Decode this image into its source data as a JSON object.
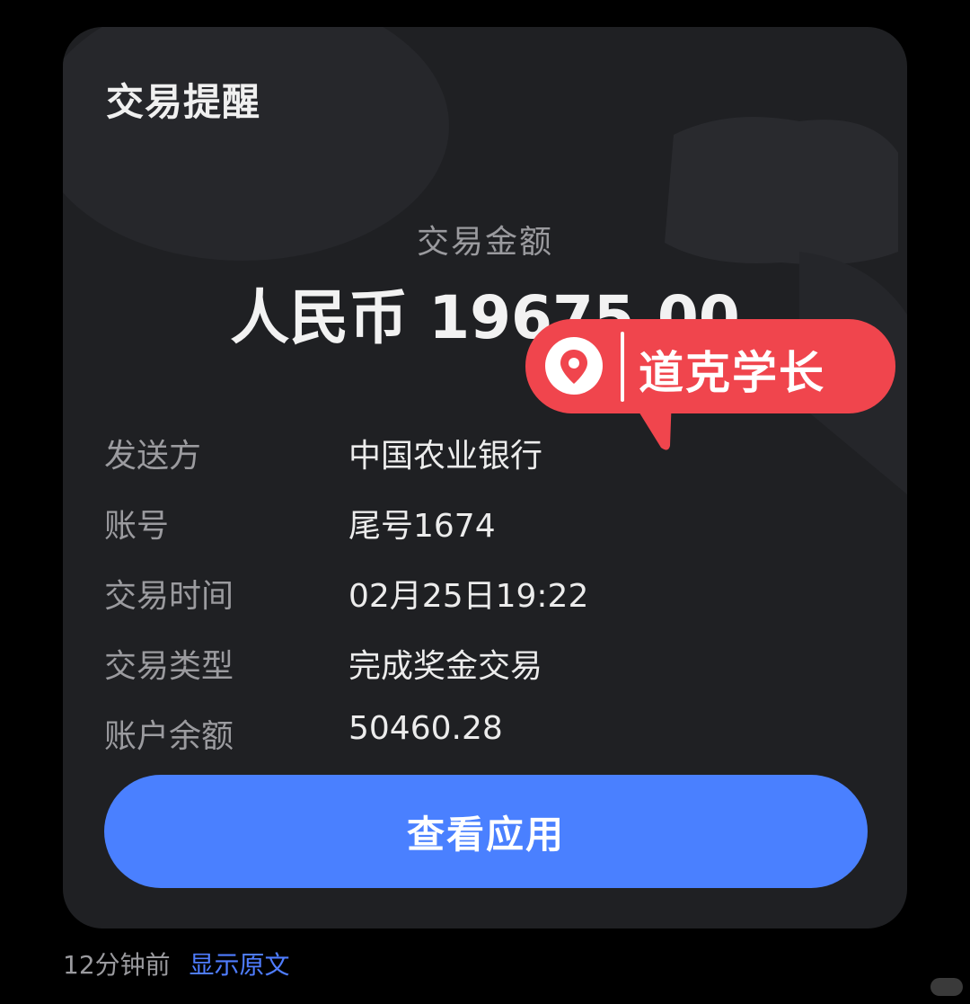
{
  "card": {
    "title": "交易提醒",
    "amount_label": "交易金额",
    "amount_value": "人民币 19675.00",
    "rows": [
      {
        "key": "发送方",
        "value": "中国农业银行"
      },
      {
        "key": "账号",
        "value": "尾号1674"
      },
      {
        "key": "交易时间",
        "value": "02月25日19:22"
      },
      {
        "key": "交易类型",
        "value": "完成奖金交易"
      },
      {
        "key": "账户余额",
        "value": "50460.28"
      }
    ],
    "cta_label": "查看应用"
  },
  "location_tag": {
    "text": "道克学长",
    "icon": "location-pin-icon",
    "color": "#f0454d"
  },
  "footer": {
    "time": "12分钟前",
    "link": "显示原文"
  },
  "colors": {
    "card_bg": "#1f2023",
    "button": "#4a80ff",
    "link": "#4f7dff"
  }
}
